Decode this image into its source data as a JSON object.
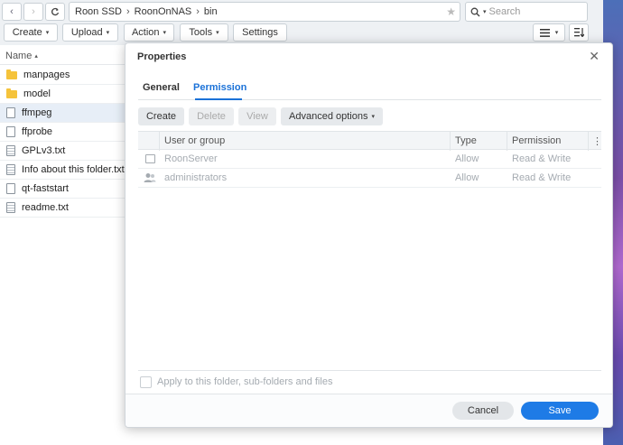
{
  "topbar": {
    "back_icon": "chevron-left-icon",
    "forward_icon": "chevron-right-icon",
    "refresh_icon": "refresh-icon",
    "path": [
      "Roon SSD",
      "RoonOnNAS",
      "bin"
    ],
    "search_placeholder": "Search",
    "toolbar": {
      "create": "Create",
      "upload": "Upload",
      "action": "Action",
      "tools": "Tools",
      "settings": "Settings"
    }
  },
  "file_list": {
    "header": "Name",
    "sort_indicator": "▴",
    "files": [
      {
        "name": "manpages",
        "icon": "folder-icon"
      },
      {
        "name": "model",
        "icon": "folder-icon"
      },
      {
        "name": "ffmpeg",
        "icon": "file-icon"
      },
      {
        "name": "ffprobe",
        "icon": "file-icon"
      },
      {
        "name": "GPLv3.txt",
        "icon": "document-icon"
      },
      {
        "name": "Info about this folder.txt",
        "icon": "document-icon"
      },
      {
        "name": "qt-faststart",
        "icon": "file-icon"
      },
      {
        "name": "readme.txt",
        "icon": "document-icon"
      }
    ]
  },
  "dialog": {
    "title": "Properties",
    "tabs": [
      "General",
      "Permission"
    ],
    "active_tab": "Permission",
    "buttons": {
      "create": "Create",
      "delete": "Delete",
      "view": "View",
      "advanced": "Advanced options"
    },
    "table": {
      "headers": [
        "User or group",
        "Type",
        "Permission"
      ],
      "rows": [
        {
          "icon": "user-icon",
          "user": "RoonServer",
          "type": "Allow",
          "permission": "Read & Write"
        },
        {
          "icon": "group-icon",
          "user": "administrators",
          "type": "Allow",
          "permission": "Read & Write"
        }
      ]
    },
    "apply_label": "Apply to this folder, sub-folders and files",
    "cancel": "Cancel",
    "save": "Save"
  },
  "colors": {
    "accent": "#1b72d8",
    "save_button": "#1e7be6",
    "folder": "#f5c33b"
  }
}
